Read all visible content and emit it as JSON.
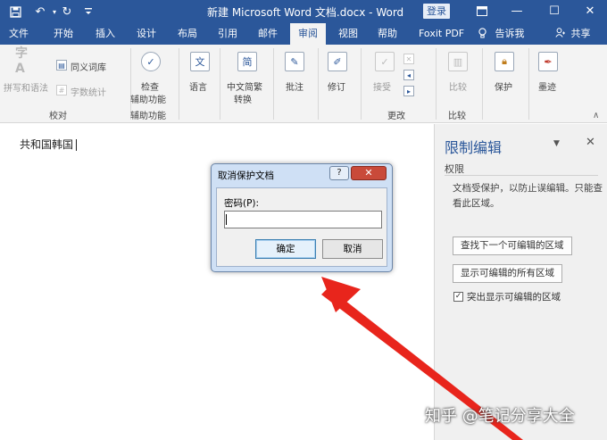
{
  "titlebar": {
    "title": "新建 Microsoft Word 文档.docx  -  Word",
    "login": "登录"
  },
  "tabs": [
    {
      "label": "文件"
    },
    {
      "label": "开始"
    },
    {
      "label": "插入"
    },
    {
      "label": "设计"
    },
    {
      "label": "布局"
    },
    {
      "label": "引用"
    },
    {
      "label": "邮件"
    },
    {
      "label": "审阅"
    },
    {
      "label": "视图"
    },
    {
      "label": "帮助"
    },
    {
      "label": "Foxit PDF"
    }
  ],
  "tell_me": "告诉我",
  "share": "共享",
  "ribbon": {
    "spell": "拼写和语法",
    "thesaurus": "同义词库",
    "word_count": "字数统计",
    "check_access_1": "检查",
    "check_access_2": "辅助功能",
    "language": "语言",
    "convert_1": "中文简繁",
    "convert_2": "转换",
    "comments": "批注",
    "track": "修订",
    "accept": "接受",
    "compare": "比较",
    "protect": "保护",
    "ink": "墨迹",
    "groups": {
      "proofing": "校对",
      "accessibility": "辅助功能",
      "changes": "更改",
      "compare": "比较"
    }
  },
  "document": {
    "text": "共和国韩国"
  },
  "pane": {
    "title": "限制编辑",
    "subtitle": "权限",
    "desc": "文档受保护，以防止误编辑。只能查看此区域。",
    "find_next": "查找下一个可编辑的区域",
    "show_all": "显示可编辑的所有区域",
    "highlight": "突出显示可编辑的区域"
  },
  "dialog": {
    "title": "取消保护文档",
    "password_label": "密码(P):",
    "password_value": "",
    "ok": "确定",
    "cancel": "取消"
  },
  "watermark": "知乎 @笔记分享大全",
  "colors": {
    "brand": "#2b579a",
    "arrow": "#e8251c"
  }
}
